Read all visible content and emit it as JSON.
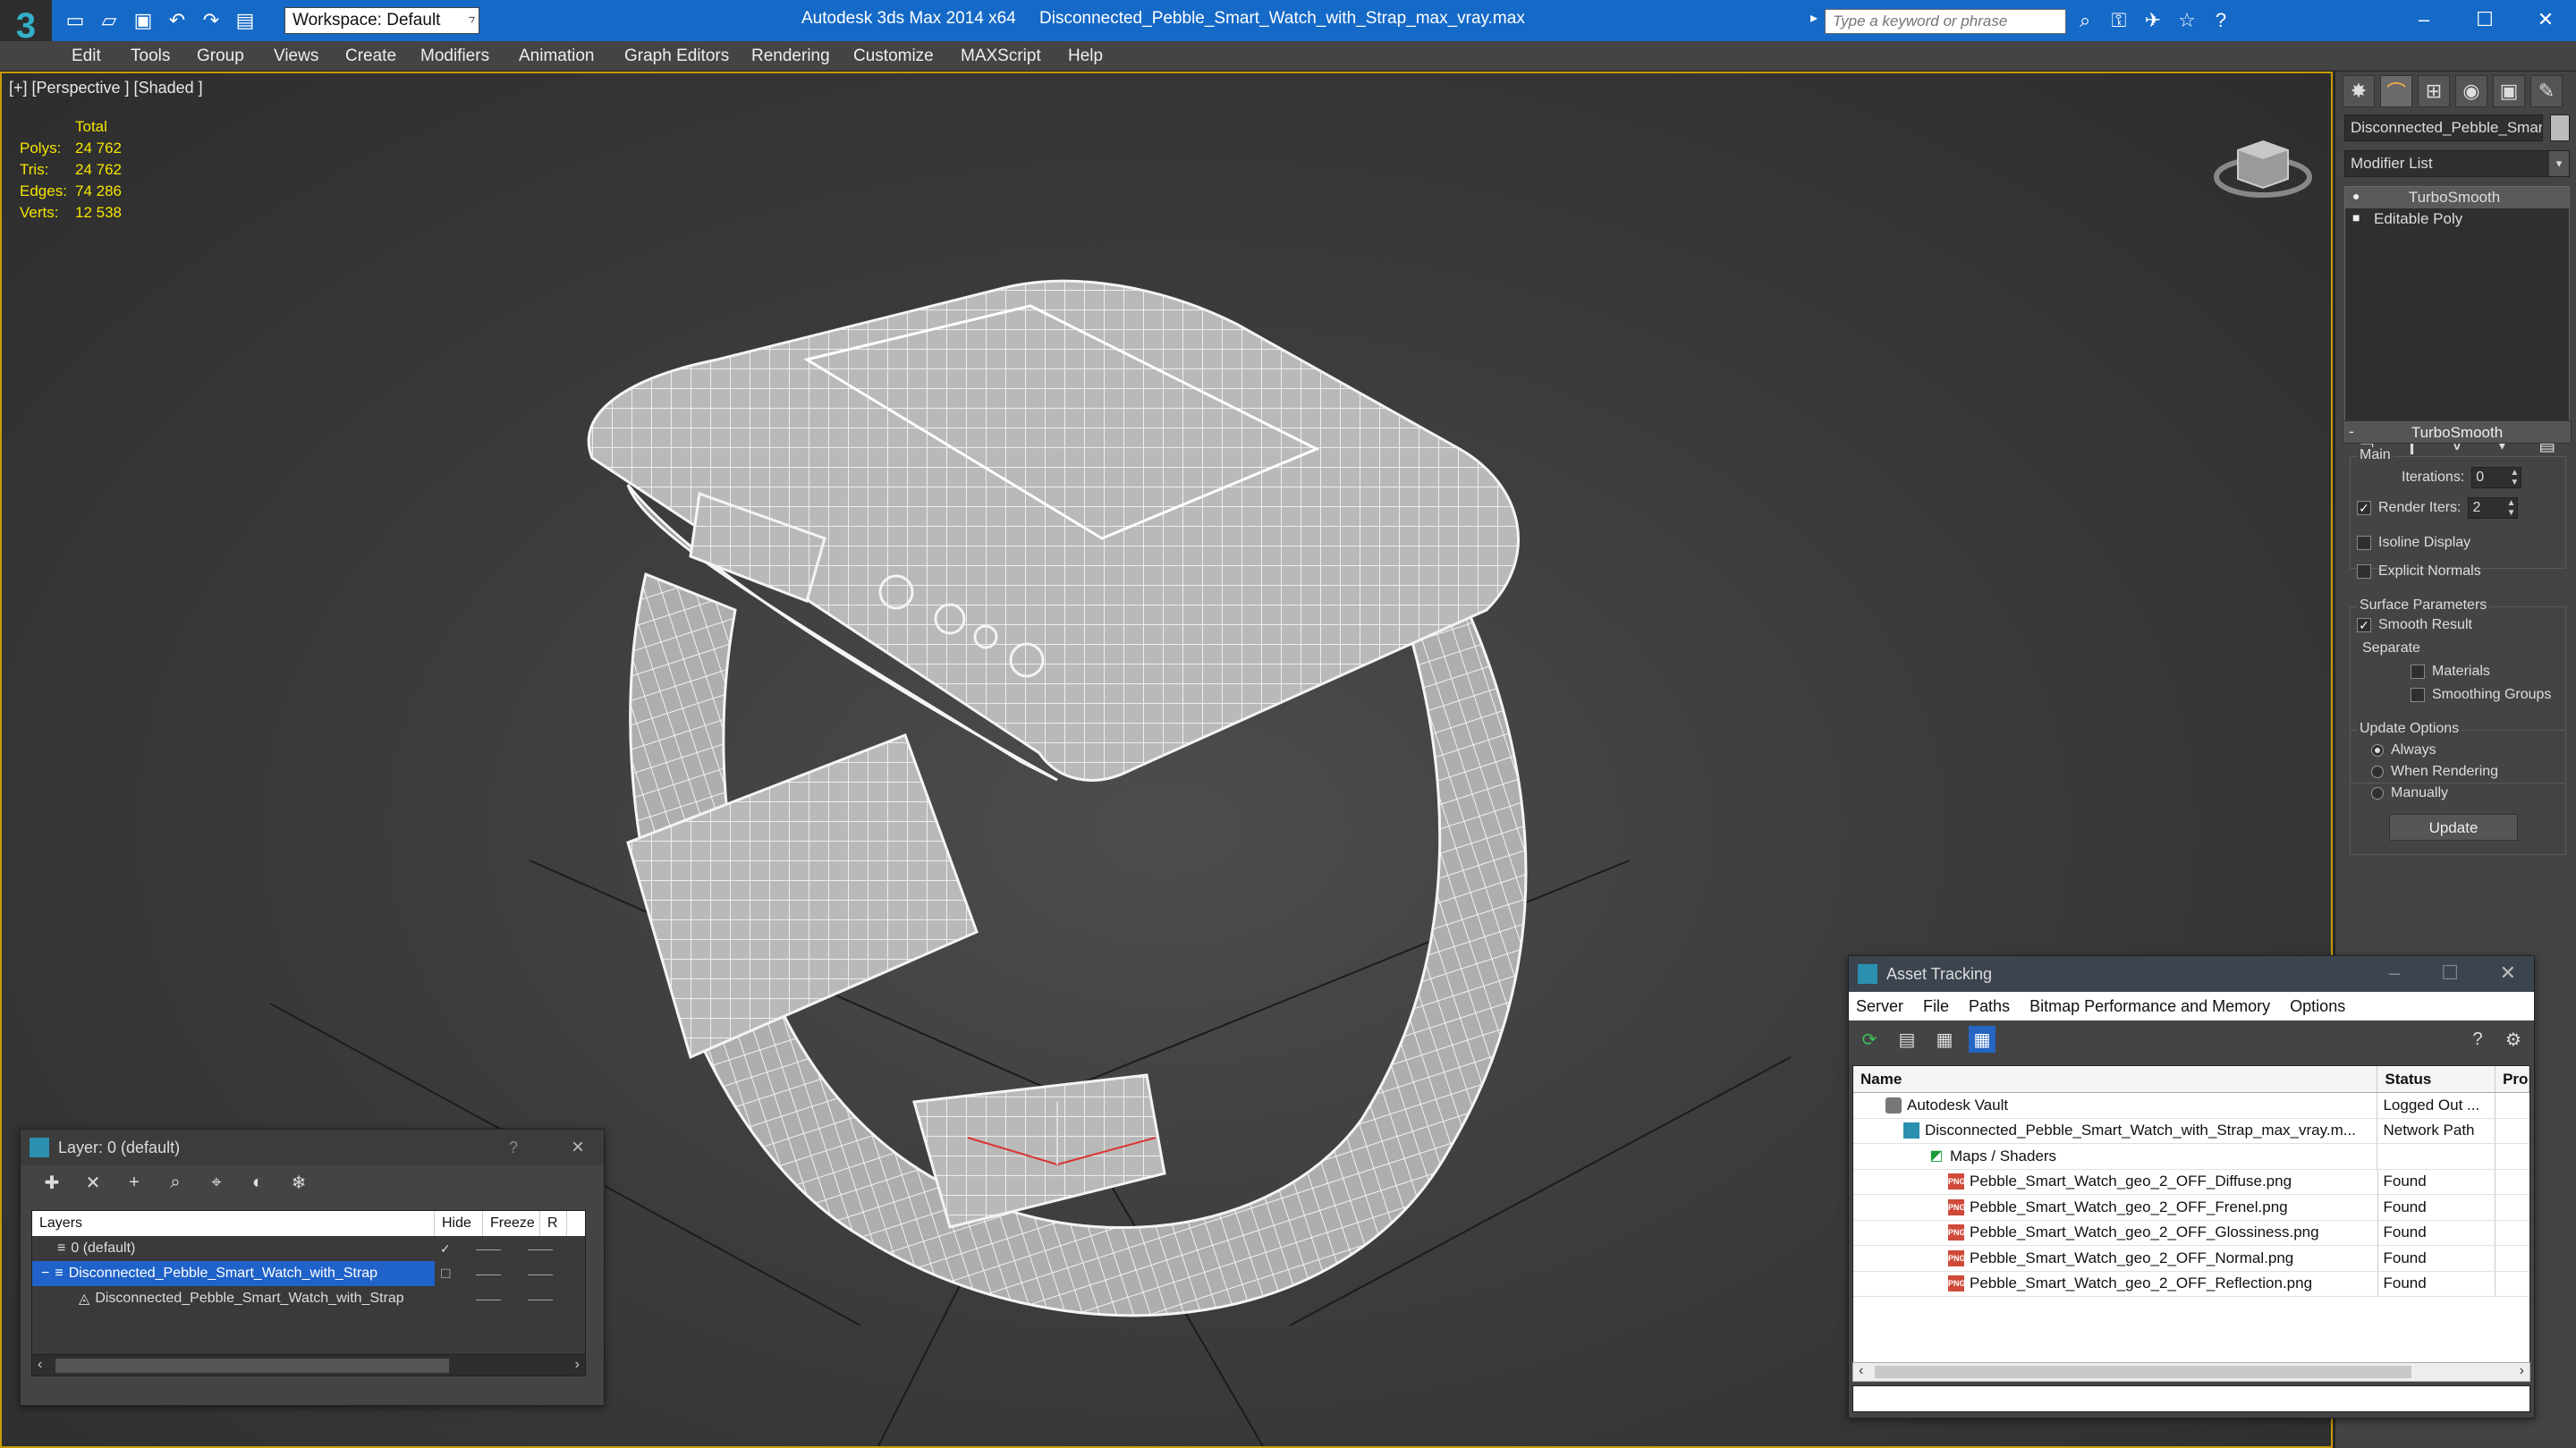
{
  "titlebar": {
    "workspace": "Workspace: Default",
    "app_title": "Autodesk 3ds Max  2014 x64",
    "file_title": "Disconnected_Pebble_Smart_Watch_with_Strap_max_vray.max",
    "search_placeholder": "Type a keyword or phrase"
  },
  "menu": [
    "Edit",
    "Tools",
    "Group",
    "Views",
    "Create",
    "Modifiers",
    "Animation",
    "Graph Editors",
    "Rendering",
    "Customize",
    "MAXScript",
    "Help"
  ],
  "viewport": {
    "label": "[+] [Perspective ] [Shaded ]",
    "stats_header": "Total",
    "stats": [
      {
        "key": "Polys:",
        "value": "24 762"
      },
      {
        "key": "Tris:",
        "value": "24 762"
      },
      {
        "key": "Edges:",
        "value": "74 286"
      },
      {
        "key": "Verts:",
        "value": "12 538"
      }
    ]
  },
  "command_panel": {
    "object_name": "Disconnected_Pebble_Smart_",
    "modifier_list": "Modifier List",
    "stack": [
      "TurboSmooth",
      "Editable Poly"
    ],
    "rollout_title": "TurboSmooth",
    "main_group": "Main",
    "iterations_label": "Iterations:",
    "iterations_value": "0",
    "render_iters_label": "Render Iters:",
    "render_iters_value": "2",
    "isoline_label": "Isoline Display",
    "explicit_normals_label": "Explicit Normals",
    "surface_group": "Surface Parameters",
    "smooth_result_label": "Smooth Result",
    "separate_label": "Separate",
    "materials_label": "Materials",
    "smoothing_groups_label": "Smoothing Groups",
    "update_group": "Update Options",
    "always_label": "Always",
    "when_rendering_label": "When Rendering",
    "manually_label": "Manually",
    "update_button": "Update"
  },
  "layer_panel": {
    "title": "Layer: 0 (default)",
    "help": "?",
    "columns": [
      "Layers",
      "Hide",
      "Freeze",
      "R"
    ],
    "rows": [
      {
        "name": "0 (default)"
      },
      {
        "name": "Disconnected_Pebble_Smart_Watch_with_Strap"
      },
      {
        "name": "Disconnected_Pebble_Smart_Watch_with_Strap"
      }
    ]
  },
  "asset_tracking": {
    "title": "Asset Tracking",
    "menu": [
      "Server",
      "File",
      "Paths",
      "Bitmap Performance and Memory",
      "Options"
    ],
    "columns": [
      "Name",
      "Status",
      "Pro"
    ],
    "rows": [
      {
        "name": "Autodesk Vault",
        "status": "Logged Out ...",
        "icon": "vault"
      },
      {
        "name": "Disconnected_Pebble_Smart_Watch_with_Strap_max_vray.m...",
        "status": "Network Path",
        "icon": "max"
      },
      {
        "name": "Maps / Shaders",
        "status": "",
        "icon": "maps"
      },
      {
        "name": "Pebble_Smart_Watch_geo_2_OFF_Diffuse.png",
        "status": "Found",
        "icon": "png"
      },
      {
        "name": "Pebble_Smart_Watch_geo_2_OFF_Frenel.png",
        "status": "Found",
        "icon": "png"
      },
      {
        "name": "Pebble_Smart_Watch_geo_2_OFF_Glossiness.png",
        "status": "Found",
        "icon": "png"
      },
      {
        "name": "Pebble_Smart_Watch_geo_2_OFF_Normal.png",
        "status": "Found",
        "icon": "png"
      },
      {
        "name": "Pebble_Smart_Watch_geo_2_OFF_Reflection.png",
        "status": "Found",
        "icon": "png"
      }
    ]
  },
  "colors": {
    "titlebar": "#1569c7",
    "viewport_border": "#c99a00",
    "stats": "#f5e400",
    "selection": "#1f62c9"
  }
}
